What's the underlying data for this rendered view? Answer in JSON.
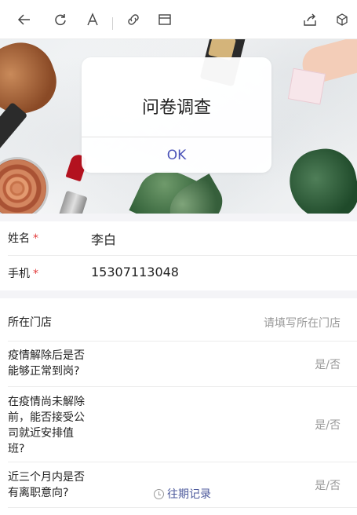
{
  "toolbar": {
    "icons": [
      "back-arrow-icon",
      "refresh-icon",
      "font-icon",
      "link-icon",
      "window-icon",
      "share-icon",
      "cube-icon"
    ]
  },
  "dialog": {
    "title": "问卷调查",
    "ok_label": "OK"
  },
  "form": {
    "name": {
      "label": "姓名",
      "required_mark": "*",
      "value": "李白"
    },
    "phone": {
      "label": "手机",
      "required_mark": "*",
      "value": "15307113048"
    },
    "store": {
      "label": "所在门店",
      "placeholder": "请填写所在门店"
    },
    "q1": {
      "label_lines": [
        "疫情解除后是否",
        "能够正常到岗?"
      ],
      "placeholder": "是/否"
    },
    "q2": {
      "label_lines": [
        "在疫情尚未解除",
        "前，能否接受公",
        "司就近安排值",
        "班?"
      ],
      "placeholder": "是/否"
    },
    "q3": {
      "label_lines": [
        "近三个月内是否",
        "有离职意向?"
      ],
      "placeholder": "是/否"
    }
  },
  "footer": {
    "history_link": "往期记录"
  },
  "colors": {
    "accent": "#4b53b8",
    "required": "#e23b3b",
    "placeholder": "#999999",
    "section_gap": "#f4f4f7"
  }
}
